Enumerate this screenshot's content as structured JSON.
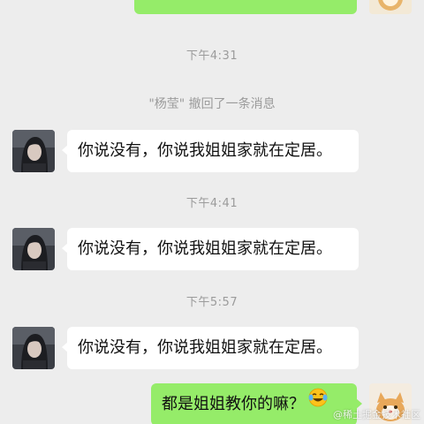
{
  "colors": {
    "background": "#ededed",
    "incoming_bubble": "#ffffff",
    "outgoing_bubble": "#95ec69",
    "system_text": "#9b9b9b"
  },
  "top_outgoing": {
    "text": "",
    "note": "partially visible outgoing bubble cut off at top edge"
  },
  "timestamps": [
    "下午4:31",
    "下午4:41",
    "下午5:57"
  ],
  "recall_notice": "\"杨莹\" 撤回了一条消息",
  "messages": [
    {
      "text": "你说没有，你说我姐姐家就在定居。"
    },
    {
      "text": "你说没有，你说我姐姐家就在定居。"
    },
    {
      "text": "你说没有，你说我姐姐家就在定居。"
    },
    {
      "text": "都是姐姐教你的嘛？",
      "emoji": "laughing-tears-emoji"
    }
  ],
  "watermark": "@稀土掘金技术社区"
}
